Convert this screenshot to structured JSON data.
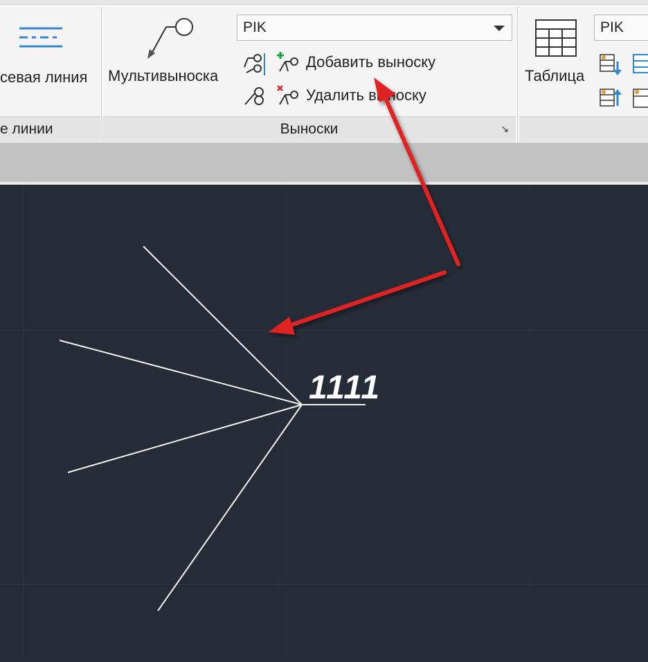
{
  "ribbon": {
    "lines_panel": {
      "button_label": "севая линия",
      "panel_title": "е линии"
    },
    "leaders_panel": {
      "multileader_label": "Мультивыноска",
      "style_combo_value": "PIK",
      "add_leader_label": "Добавить выноску",
      "remove_leader_label": "Удалить выноску",
      "panel_title": "Выноски",
      "launcher_glyph": "↘"
    },
    "tables_panel": {
      "table_label": "Таблица",
      "style_combo_value": "PIK"
    }
  },
  "canvas": {
    "mleader_text": "1111",
    "background_color": "#262c37",
    "annotation_arrow_color": "#e02020"
  }
}
